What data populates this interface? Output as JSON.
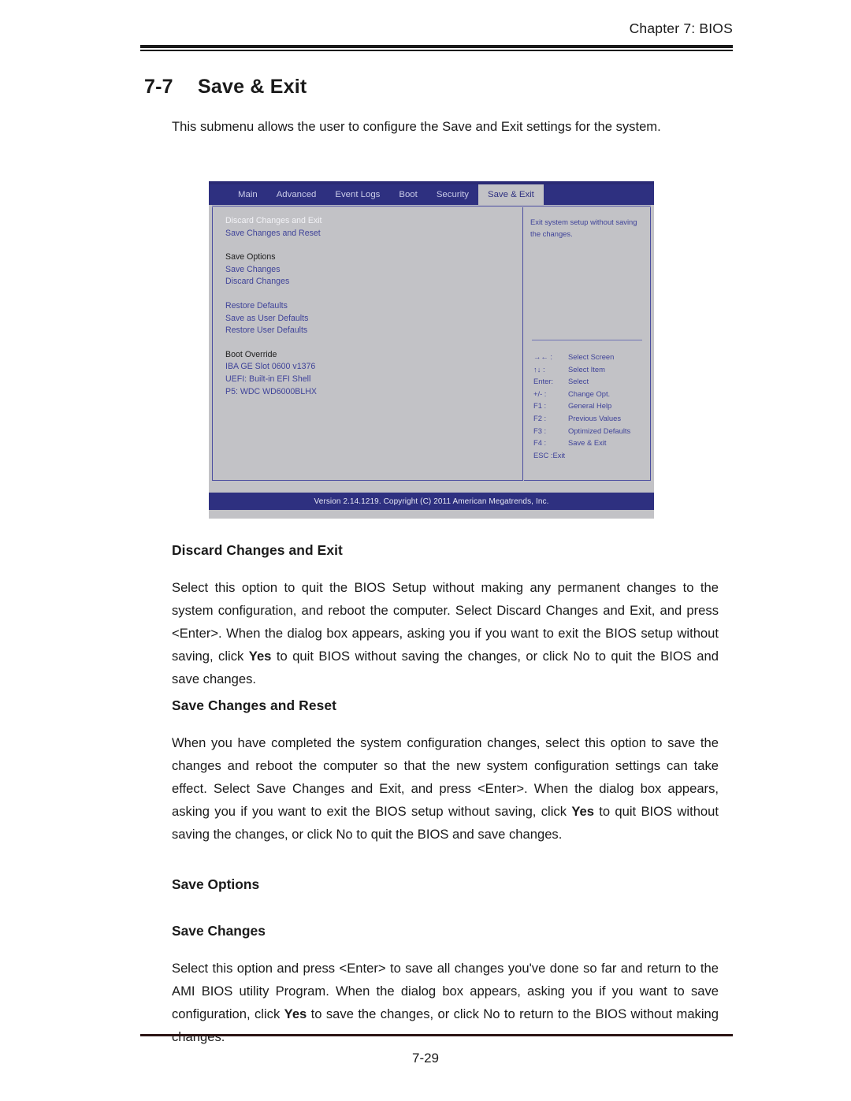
{
  "page": {
    "running_head": "Chapter 7: BIOS",
    "page_number": "7-29"
  },
  "section": {
    "number": "7-7",
    "title": "Save & Exit",
    "intro": "This submenu allows the user to configure the Save and Exit settings for the system."
  },
  "bios": {
    "tabs": [
      {
        "label": "Main",
        "selected": false
      },
      {
        "label": "Advanced",
        "selected": false
      },
      {
        "label": "Event Logs",
        "selected": false
      },
      {
        "label": "Boot",
        "selected": false
      },
      {
        "label": "Security",
        "selected": false
      },
      {
        "label": "Save & Exit",
        "selected": true
      }
    ],
    "menu": [
      {
        "label": "Discard Changes and Exit",
        "kind": "highlighted"
      },
      {
        "label": "Save Changes and Reset",
        "kind": "item"
      },
      {
        "label": "",
        "kind": "gap"
      },
      {
        "label": "Save Options",
        "kind": "header"
      },
      {
        "label": "Save Changes",
        "kind": "item"
      },
      {
        "label": "Discard Changes",
        "kind": "item"
      },
      {
        "label": "",
        "kind": "gap"
      },
      {
        "label": "Restore Defaults",
        "kind": "item"
      },
      {
        "label": "Save as User Defaults",
        "kind": "item"
      },
      {
        "label": "Restore User Defaults",
        "kind": "item"
      },
      {
        "label": "",
        "kind": "gap"
      },
      {
        "label": "Boot Override",
        "kind": "header"
      },
      {
        "label": "IBA GE Slot 0600 v1376",
        "kind": "item"
      },
      {
        "label": "UEFI: Built-in EFI Shell",
        "kind": "item"
      },
      {
        "label": "P5: WDC WD6000BLHX",
        "kind": "item"
      }
    ],
    "help": "Exit system setup without saving the changes.",
    "keys": [
      {
        "key": "→← :",
        "action": "Select Screen"
      },
      {
        "key": "↑↓  :",
        "action": "Select Item"
      },
      {
        "key": "Enter:",
        "action": "Select"
      },
      {
        "key": "+/-  :",
        "action": "Change Opt."
      },
      {
        "key": "F1 :",
        "action": "General Help"
      },
      {
        "key": "F2 :",
        "action": "Previous Values"
      },
      {
        "key": "F3 :",
        "action": "Optimized Defaults"
      },
      {
        "key": "F4 :",
        "action": "Save & Exit"
      },
      {
        "key": "ESC :Exit",
        "action": ""
      }
    ],
    "version": "Version 2.14.1219. Copyright (C) 2011 American Megatrends, Inc."
  },
  "content": {
    "discard": {
      "heading": "Discard Changes and Exit",
      "body_1": "Select this option to quit the BIOS Setup without making any permanent changes to the system configuration, and reboot the computer. Select Discard Changes and Exit, and press <Enter>. When the dialog box appears, asking you if you want to exit the BIOS setup without saving, click ",
      "bold_1": "Yes",
      "body_2": " to quit BIOS without saving the changes, or click No to quit the BIOS and save changes."
    },
    "save_reset": {
      "heading": "Save Changes and Reset",
      "body_1": "When you have completed the system configuration changes, select this option to save the changes and reboot the computer so that the new system configuration settings can take effect. Select Save Changes and Exit, and press <Enter>.  When the dialog box appears, asking you if you want to exit the BIOS setup without saving, click ",
      "bold_1": "Yes",
      "body_2": " to quit BIOS without saving the changes, or click No to quit the BIOS and save changes."
    },
    "save_options": {
      "heading": "Save Options",
      "sub_heading": "Save Changes",
      "body_1": "Select this option and press <Enter> to save all changes you've done so far and return to the AMI BIOS utility Program. When the dialog box appears, asking you if you want to save configuration, click ",
      "bold_1": "Yes",
      "body_2": " to save the changes, or click No to return to the BIOS without making changes."
    }
  }
}
